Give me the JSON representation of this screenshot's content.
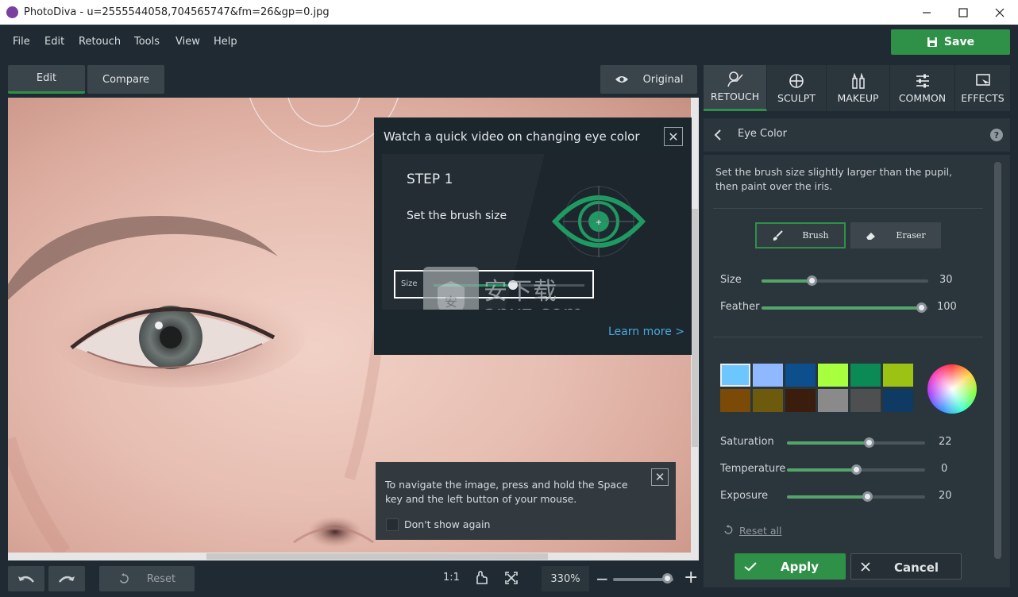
{
  "window": {
    "title": "PhotoDiva - u=2555544058,704565747&fm=26&gp=0.jpg"
  },
  "menu": [
    "File",
    "Edit",
    "Retouch",
    "Tools",
    "View",
    "Help"
  ],
  "save_label": "Save",
  "view_tabs": {
    "edit": "Edit",
    "compare": "Compare",
    "original": "Original"
  },
  "video_popup": {
    "title": "Watch a quick video on changing eye color",
    "step": "STEP 1",
    "step_text": "Set the brush size",
    "demo_slider_label": "Size",
    "learn_more": "Learn more >"
  },
  "watermark": {
    "text": "anxz.com",
    "cjk": "安下载"
  },
  "nav_popup": {
    "text": "To navigate the image, press and hold the Space key and the left button of your mouse.",
    "dont_show": "Don't show again"
  },
  "bottom": {
    "reset_label": "Reset",
    "ratio_label": "1:1",
    "zoom": "330%",
    "zoom_level": 0.75
  },
  "tool_tabs": [
    {
      "label": "RETOUCH",
      "icon": "retouch-icon",
      "active": true
    },
    {
      "label": "SCULPT",
      "icon": "sculpt-icon",
      "active": false
    },
    {
      "label": "MAKEUP",
      "icon": "makeup-icon",
      "active": false
    },
    {
      "label": "COMMON",
      "icon": "common-icon",
      "active": false
    },
    {
      "label": "EFFECTS",
      "icon": "effects-icon",
      "active": false
    }
  ],
  "panel": {
    "title": "Eye Color",
    "help": "?",
    "instructions": "Set the brush size slightly larger than the pupil, then paint over the iris.",
    "brush_label": "Brush",
    "eraser_label": "Eraser",
    "size": {
      "label": "Size",
      "value": "30",
      "fraction": 0.3
    },
    "feather": {
      "label": "Feather",
      "value": "100",
      "fraction": 1.0
    },
    "swatches": [
      "#6ec6ff",
      "#8fb8ff",
      "#0c4f8c",
      "#a8ff3e",
      "#0b8a55",
      "#9cc314",
      "#7a4a06",
      "#6e5a0c",
      "#3a1d0c",
      "#8a8a8a",
      "#4d4f51",
      "#0e3a63"
    ],
    "saturation": {
      "label": "Saturation",
      "value": "22",
      "fraction": 0.59
    },
    "temperature": {
      "label": "Temperature",
      "value": "0",
      "fraction": 0.5
    },
    "exposure": {
      "label": "Exposure",
      "value": "20",
      "fraction": 0.58
    },
    "reset_all": "Reset all",
    "apply": "Apply",
    "cancel": "Cancel"
  },
  "colors": {
    "accent": "#2f9148",
    "link": "#4aa8de",
    "panel_bg": "#2b353c",
    "app_bg": "#1f2a32"
  }
}
